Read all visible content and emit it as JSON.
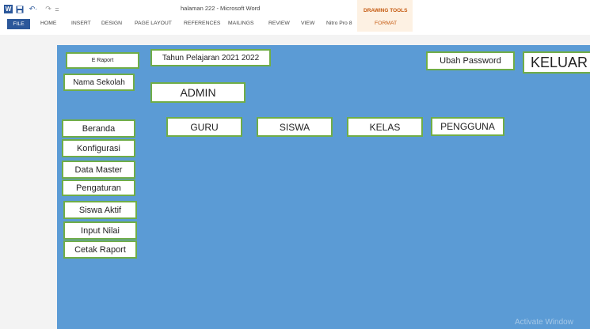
{
  "window": {
    "title": "halaman 222 - Microsoft Word"
  },
  "quick_access": {
    "word_icon": "W",
    "undo": "↶·",
    "redo": "↷",
    "customize": "="
  },
  "contextual": {
    "group_label": "DRAWING TOOLS"
  },
  "ribbon_tabs": [
    "FILE",
    "HOME",
    "INSERT",
    "DESIGN",
    "PAGE LAYOUT",
    "REFERENCES",
    "MAILINGS",
    "REVIEW",
    "VIEW",
    "Nitro Pro 8",
    "FORMAT"
  ],
  "app": {
    "e_raport": "E Raport",
    "school_name": "Nama Sekolah",
    "school_year": "Tahun Pelajaran 2021 2022",
    "role": "ADMIN",
    "change_password": "Ubah Password",
    "logout": "KELUAR"
  },
  "menu": [
    "Beranda",
    "Konfigurasi",
    "Data Master",
    "Pengaturan",
    "Siswa Aktif",
    "Input Nilai",
    "Cetak Raport"
  ],
  "top_menu": [
    "GURU",
    "SISWA",
    "KELAS",
    "PENGGUNA"
  ],
  "watermark": "Activate Window",
  "colors": {
    "canvas": "#5b9bd5",
    "box_border": "#70ad47",
    "ribbon_accent": "#2b579a",
    "contextual_tab": "#c55a11"
  }
}
